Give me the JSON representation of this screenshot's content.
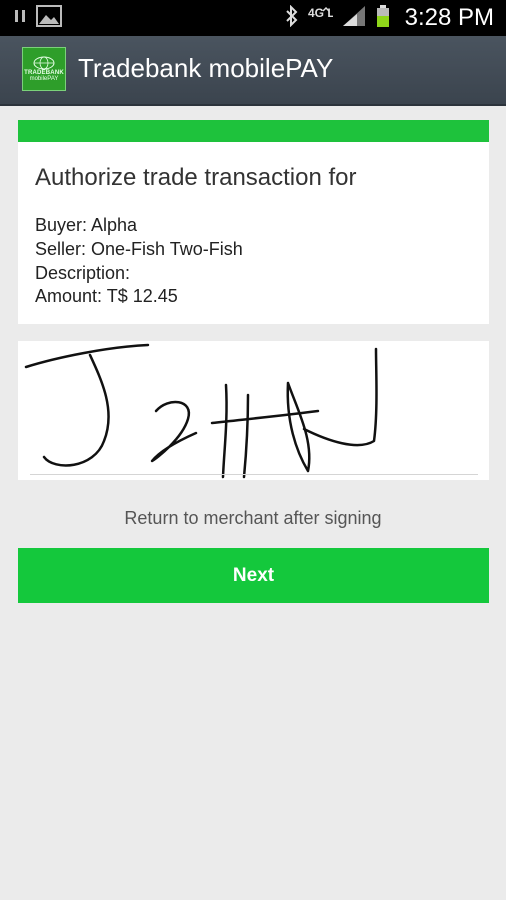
{
  "status_bar": {
    "time": "3:28 PM",
    "network": "4G LTE",
    "icons": [
      "pause-icon",
      "image-icon",
      "bluetooth-icon",
      "4g-lte-icon",
      "signal-icon",
      "battery-icon"
    ]
  },
  "app_bar": {
    "title": "Tradebank mobilePAY",
    "logo_text_top": "TRADEBANK",
    "logo_text_bottom": "mobilePAY"
  },
  "transaction": {
    "heading": "Authorize trade transaction for",
    "buyer": "Buyer: Alpha",
    "seller": "Seller: One-Fish Two-Fish",
    "description": "Description:",
    "amount": "Amount: T$ 12.45",
    "accent_color": "#1ec23c"
  },
  "signature": {
    "text": "JoHN"
  },
  "return_note": "Return to merchant after signing",
  "next_button": {
    "label": "Next",
    "color": "#14c83c"
  }
}
